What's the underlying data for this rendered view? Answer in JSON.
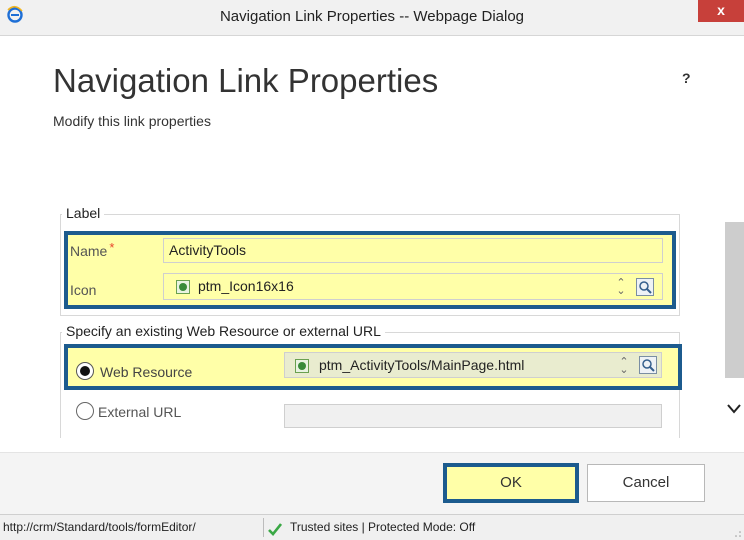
{
  "window": {
    "title": "Navigation Link Properties -- Webpage Dialog",
    "close_label": "x"
  },
  "dialog": {
    "heading": "Navigation Link Properties",
    "subheading": "Modify this link properties",
    "help_label": "?"
  },
  "label_section": {
    "legend": "Label",
    "name_label": "Name",
    "required_marker": "*",
    "name_value": "ActivityTools",
    "icon_label": "Icon",
    "icon_value": "ptm_Icon16x16"
  },
  "target_section": {
    "legend": "Specify an existing Web Resource or external URL",
    "web_resource_label": "Web Resource",
    "web_resource_value": "ptm_ActivityTools/MainPage.html",
    "web_resource_selected": true,
    "external_url_label": "External URL",
    "external_url_value": ""
  },
  "buttons": {
    "ok_label": "OK",
    "cancel_label": "Cancel"
  },
  "status_bar": {
    "url": "http://crm/Standard/tools/formEditor/",
    "zone": "Trusted sites | Protected Mode: Off"
  },
  "colors": {
    "highlight": "#ffffa8",
    "frame": "#1c5b8e",
    "required": "#e8442b",
    "close_button": "#c7403a"
  }
}
